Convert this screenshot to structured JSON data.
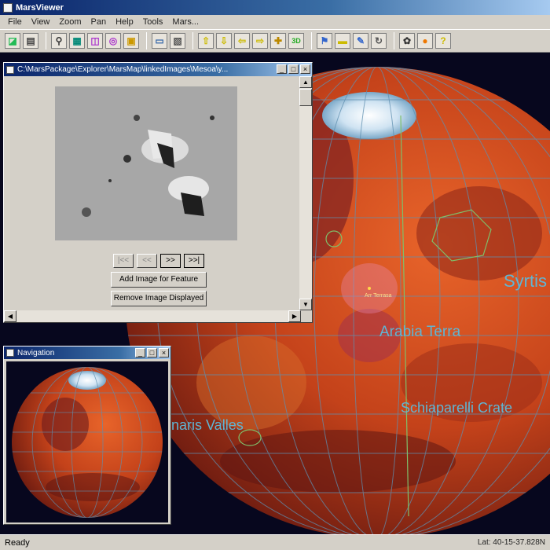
{
  "app": {
    "title": "MarsViewer"
  },
  "menu": [
    "File",
    "View",
    "Zoom",
    "Pan",
    "Help",
    "Tools",
    "Mars..."
  ],
  "toolbar": {
    "buttons": [
      {
        "icon": "save-icon",
        "glyph": "◪"
      },
      {
        "icon": "print-icon",
        "glyph": "▤"
      },
      {
        "icon": "pin-icon",
        "glyph": "⚲"
      },
      {
        "icon": "grid-icon",
        "glyph": "▦"
      },
      {
        "icon": "layers-icon",
        "glyph": "◫"
      },
      {
        "icon": "target-icon",
        "glyph": "◎"
      },
      {
        "icon": "image-icon",
        "glyph": "▣"
      },
      {
        "icon": "window-icon",
        "glyph": "▭"
      },
      {
        "icon": "photo-icon",
        "glyph": "▧"
      },
      {
        "icon": "arrow-up-icon",
        "glyph": "⇧"
      },
      {
        "icon": "arrow-down-icon",
        "glyph": "⇩"
      },
      {
        "icon": "arrow-left-icon",
        "glyph": "⇦"
      },
      {
        "icon": "arrow-right-icon",
        "glyph": "⇨"
      },
      {
        "icon": "center-icon",
        "glyph": "✚"
      },
      {
        "icon": "view-3d-icon",
        "glyph": "3D"
      },
      {
        "icon": "measure-icon",
        "glyph": "⚑"
      },
      {
        "icon": "label-icon",
        "glyph": "▬"
      },
      {
        "icon": "draw-icon",
        "glyph": "✎"
      },
      {
        "icon": "rotate-icon",
        "glyph": "↻"
      },
      {
        "icon": "settings-icon",
        "glyph": "✿"
      },
      {
        "icon": "sun-icon",
        "glyph": "●"
      },
      {
        "icon": "help-icon",
        "glyph": "?"
      }
    ]
  },
  "image_window": {
    "path": "C:\\MarsPackage\\Explorer\\MarsMap\\linkedImages\\Mesoa\\y...",
    "nav_buttons": [
      "|<<",
      "<<",
      ">>",
      ">>|"
    ],
    "add_button": "Add Image for Feature",
    "remove_button": "Remove Image Displayed"
  },
  "nav_window": {
    "title": "Navigation"
  },
  "map_labels": {
    "syrtis": "Syrtis",
    "arabia": "Arabia Terra",
    "schiaparelli": "Schiaparelli Crate",
    "valles": "inaris Valles",
    "feature": "Arr Terrasa"
  },
  "status": {
    "left": "Ready",
    "coords": "Lat: 40-15-37.828N"
  },
  "colors": {
    "space": "#07071e",
    "mars": "#c9431a",
    "grid": "#5f8fb0",
    "label": "#5fb5d4"
  }
}
